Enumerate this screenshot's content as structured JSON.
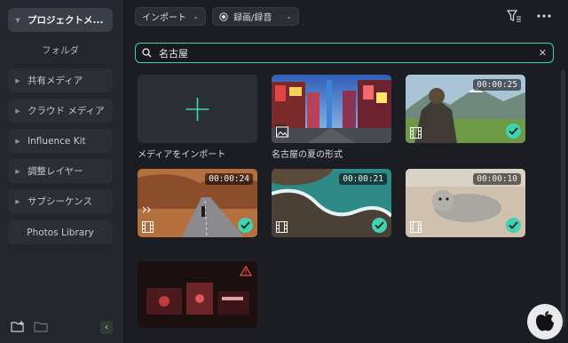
{
  "sidebar": {
    "project_media": "プロジェクトメ...",
    "folder": "フォルダ",
    "items": [
      {
        "label": "共有メディア"
      },
      {
        "label": "クラウド メディア"
      },
      {
        "label": "Influence Kit"
      },
      {
        "label": "調整レイヤー"
      },
      {
        "label": "サブシーケンス"
      }
    ],
    "photos_library": "Photos Library"
  },
  "toolbar": {
    "import_label": "インポート",
    "record_label": "録画/録音"
  },
  "search": {
    "value": "名古屋"
  },
  "media": {
    "import_tile_caption": "メディアをインポート",
    "items": [
      {
        "caption": "名古屋の夏の形式",
        "duration": "",
        "checked": false
      },
      {
        "caption": "",
        "duration": "00:00:25",
        "checked": true
      },
      {
        "caption": "",
        "duration": "00:00:24",
        "checked": true
      },
      {
        "caption": "",
        "duration": "00:00:21",
        "checked": true
      },
      {
        "caption": "",
        "duration": "00:00:10",
        "checked": true
      },
      {
        "caption": "",
        "duration": "",
        "checked": false
      }
    ]
  },
  "colors": {
    "accent": "#3fd3b2",
    "background": "#1b1d22",
    "sidebar": "#23262c"
  }
}
